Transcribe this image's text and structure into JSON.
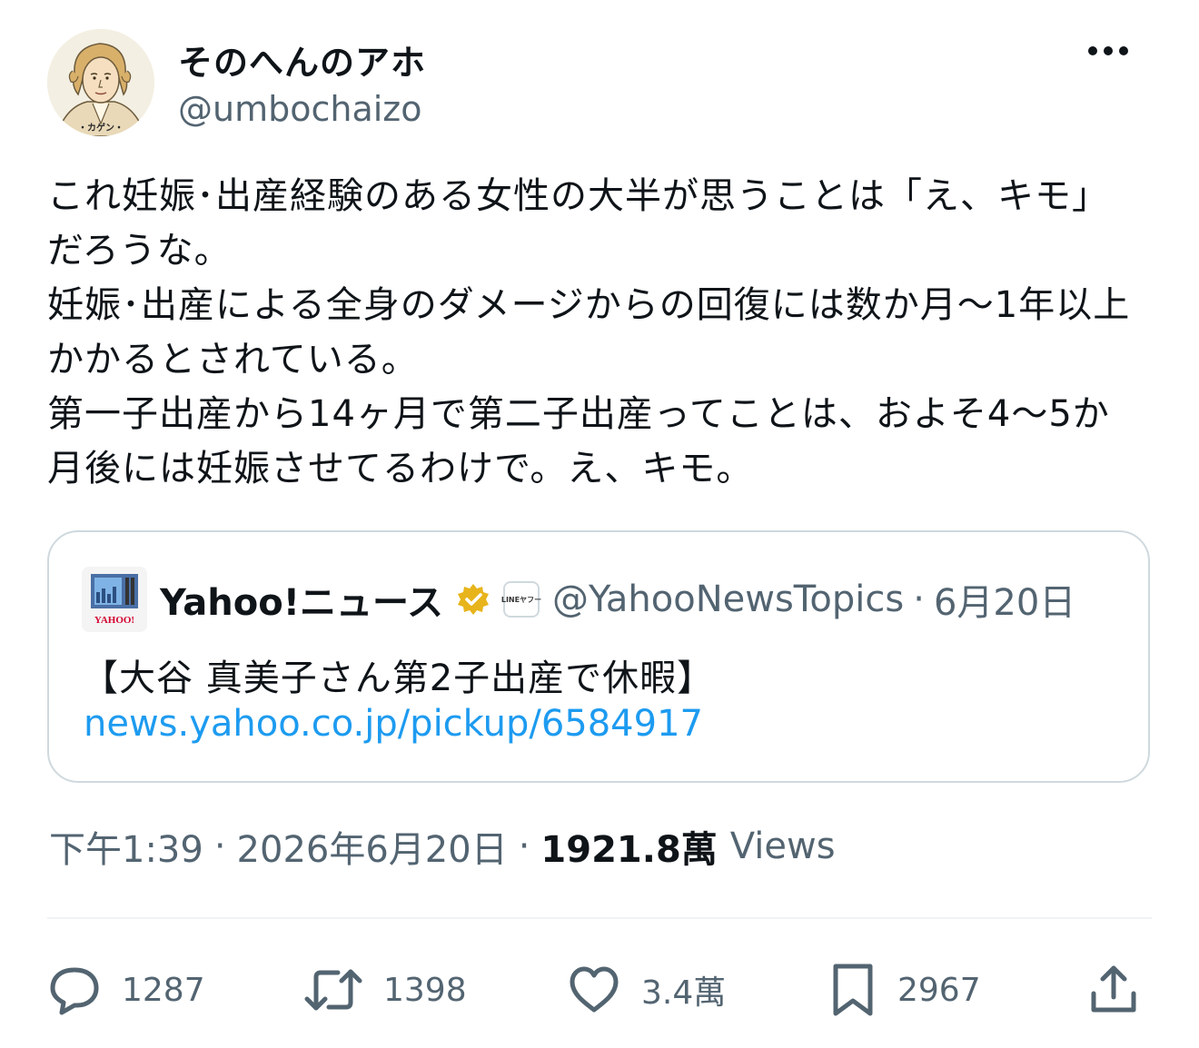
{
  "author": {
    "display_name": "そのへんのアホ",
    "handle": "@umbochaizo",
    "avatar_caption": "・カゲン・"
  },
  "tweet": {
    "lines": [
      "これ妊娠･出産経験のある女性の大半が思うことは「え、キモ」",
      "だろうな。",
      "妊娠･出産による全身のダメージからの回復には数か月～1年以上",
      "かかるとされている。",
      "第一子出産から14ヶ月で第二子出産ってことは、およそ4～5か",
      "月後には妊娠させてるわけで。え、キモ。"
    ]
  },
  "quote": {
    "avatar_text": "YAHOO!",
    "affiliate_badge_text": "LINEヤフー",
    "name": "Yahoo!ニュース",
    "handle": "@YahooNewsTopics",
    "separator": "·",
    "date": "6月20日",
    "text": "【大谷 真美子さん第2子出産で休暇】",
    "link": "news.yahoo.co.jp/pickup/6584917"
  },
  "meta": {
    "time": "下午1:39",
    "separator": "·",
    "date": "2026年6月20日",
    "views_count": "1921.8萬",
    "views_label": "Views"
  },
  "actions": {
    "replies": "1287",
    "retweets": "1398",
    "likes": "3.4萬",
    "bookmarks": "2967"
  },
  "colors": {
    "text_primary": "#0f1419",
    "text_secondary": "#536471",
    "link": "#1d9bf0",
    "border": "#cfd9de",
    "verified_gold": "#e8b41c"
  },
  "icons": [
    "more-icon",
    "verified-badge-icon",
    "reply-icon",
    "retweet-icon",
    "like-icon",
    "bookmark-icon",
    "share-icon"
  ]
}
